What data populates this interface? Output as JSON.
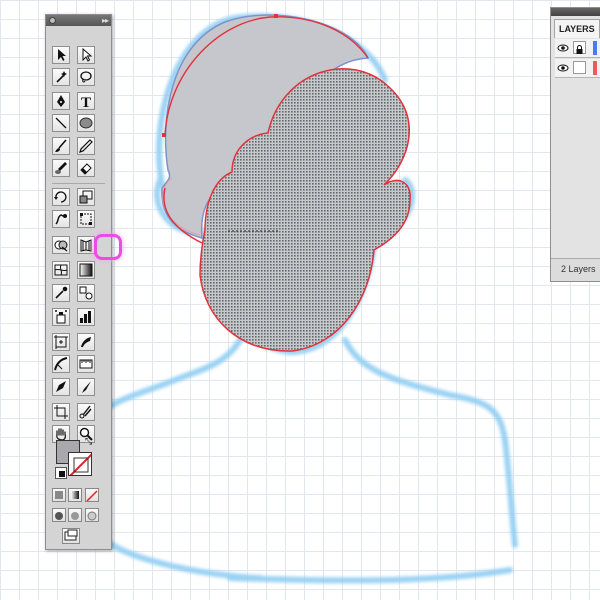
{
  "tools_panel": {
    "tools": [
      {
        "name": "selection-tool-icon",
        "active": false
      },
      {
        "name": "direct-selection-tool-icon",
        "active": false
      },
      {
        "name": "magic-wand-tool-icon",
        "active": false
      },
      {
        "name": "lasso-tool-icon",
        "active": false
      },
      {
        "name": "pen-tool-icon",
        "active": false
      },
      {
        "name": "type-tool-icon",
        "active": false
      },
      {
        "name": "line-segment-tool-icon",
        "active": false
      },
      {
        "name": "ellipse-tool-icon",
        "active": false
      },
      {
        "name": "paintbrush-tool-icon",
        "active": false
      },
      {
        "name": "pencil-tool-icon",
        "active": false
      },
      {
        "name": "blob-brush-tool-icon",
        "active": false
      },
      {
        "name": "eraser-tool-icon",
        "active": false
      },
      {
        "name": "rotate-tool-icon",
        "active": false
      },
      {
        "name": "scale-tool-icon",
        "active": false
      },
      {
        "name": "warp-tool-icon",
        "active": false
      },
      {
        "name": "free-transform-tool-icon",
        "active": false
      },
      {
        "name": "shape-builder-tool-icon",
        "active": true
      },
      {
        "name": "perspective-grid-tool-icon",
        "active": false
      },
      {
        "name": "mesh-tool-icon",
        "active": false
      },
      {
        "name": "gradient-tool-icon",
        "active": false
      },
      {
        "name": "eyedropper-tool-icon",
        "active": false
      },
      {
        "name": "blend-tool-icon",
        "active": false
      },
      {
        "name": "symbol-sprayer-tool-icon",
        "active": false
      },
      {
        "name": "column-graph-tool-icon",
        "active": false
      },
      {
        "name": "artboard-tool-icon",
        "active": false
      },
      {
        "name": "slice-tool-icon",
        "active": false
      },
      {
        "name": "width-tool-icon",
        "active": false
      },
      {
        "name": "ruler-tool-icon",
        "active": false
      },
      {
        "name": "pen-nib-tool-icon",
        "active": false
      },
      {
        "name": "knife-tool-icon",
        "active": false
      },
      {
        "name": "crop-area-tool-icon",
        "active": false
      },
      {
        "name": "scissors-tool-icon",
        "active": false
      },
      {
        "name": "hand-tool-icon",
        "active": false
      },
      {
        "name": "zoom-tool-icon",
        "active": false
      }
    ],
    "fill_color": "#a8a8ad",
    "stroke_color": "none"
  },
  "layers_panel": {
    "tab_label": "LAYERS",
    "layers": [
      {
        "color": "#4a7cf0",
        "locked": true
      },
      {
        "color": "#ee5a5a",
        "locked": false
      }
    ],
    "count_label": "2 Layers"
  },
  "colors": {
    "sketch_blue": "#8fcdf2",
    "selection_red": "#e0333c",
    "shape_fill": "#c6c7cc",
    "highlight_ring": "#ea4ce5"
  }
}
